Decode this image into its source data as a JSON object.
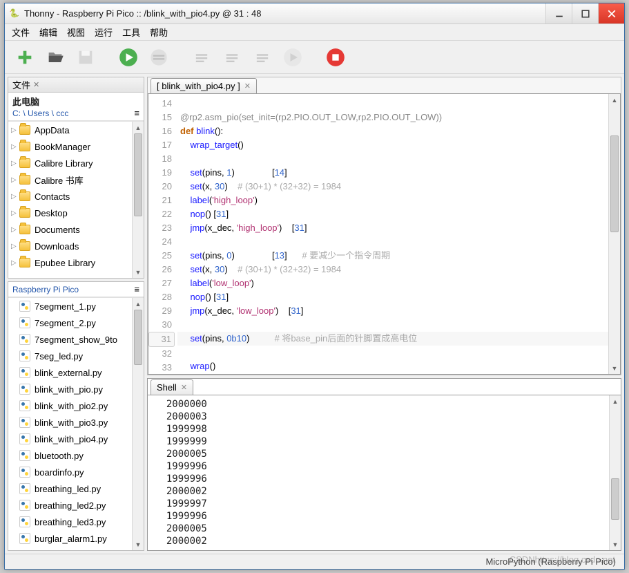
{
  "window": {
    "title": "Thonny  -  Raspberry Pi Pico :: /blink_with_pio4.py  @  31 : 48"
  },
  "menu": [
    "文件",
    "编辑",
    "视图",
    "运行",
    "工具",
    "帮助"
  ],
  "toolbar_icons": [
    "new",
    "open",
    "save",
    "run",
    "debug",
    "step-over",
    "step-into",
    "step-out",
    "resume",
    "stop"
  ],
  "files_panel": {
    "title": "文件",
    "computer_label": "此电脑",
    "path": "C: \\ Users \\ ccc",
    "folders": [
      "AppData",
      "BookManager",
      "Calibre Library",
      "Calibre 书库",
      "Contacts",
      "Desktop",
      "Documents",
      "Downloads",
      "Epubee Library"
    ],
    "device_label": "Raspberry Pi Pico",
    "device_files": [
      "7segment_1.py",
      "7segment_2.py",
      "7segment_show_9to",
      "7seg_led.py",
      "blink_external.py",
      "blink_with_pio.py",
      "blink_with_pio2.py",
      "blink_with_pio3.py",
      "blink_with_pio4.py",
      "bluetooth.py",
      "boardinfo.py",
      "breathing_led.py",
      "breathing_led2.py",
      "breathing_led3.py",
      "burglar_alarm1.py"
    ]
  },
  "editor": {
    "tab_label": "[ blink_with_pio4.py ]",
    "first_line_no": 14,
    "current_line_no": 31,
    "lines": [
      {
        "n": 14,
        "t": ""
      },
      {
        "n": 15,
        "t": "@rp2.asm_pio(set_init=(rp2.PIO.OUT_LOW,rp2.PIO.OUT_LOW))",
        "deco": true
      },
      {
        "n": 16,
        "t": "def blink():",
        "def": true
      },
      {
        "n": 17,
        "t": "    wrap_target()"
      },
      {
        "n": 18,
        "t": ""
      },
      {
        "n": 19,
        "t": "    set(pins, 1)               [14]",
        "nums": [
          [
            "1"
          ],
          [
            "14"
          ]
        ]
      },
      {
        "n": 20,
        "t": "    set(x, 30)    # (30+1) * (32+32) = 1984",
        "num": "30",
        "cmt_from": "#"
      },
      {
        "n": 21,
        "t": "    label('high_loop')",
        "str": "'high_loop'"
      },
      {
        "n": 22,
        "t": "    nop() [31]",
        "nums": [
          [
            "31"
          ]
        ]
      },
      {
        "n": 23,
        "t": "    jmp(x_dec, 'high_loop')    [31]",
        "str": "'high_loop'",
        "nums": [
          [
            "31"
          ]
        ]
      },
      {
        "n": 24,
        "t": ""
      },
      {
        "n": 25,
        "t": "    set(pins, 0)               [13]      # 要减少一个指令周期",
        "nums": [
          [
            "0"
          ],
          [
            "13"
          ]
        ],
        "cmt_from": "#"
      },
      {
        "n": 26,
        "t": "    set(x, 30)    # (30+1) * (32+32) = 1984",
        "num": "30",
        "cmt_from": "#"
      },
      {
        "n": 27,
        "t": "    label('low_loop')",
        "str": "'low_loop'"
      },
      {
        "n": 28,
        "t": "    nop() [31]",
        "nums": [
          [
            "31"
          ]
        ]
      },
      {
        "n": 29,
        "t": "    jmp(x_dec, 'low_loop')    [31]",
        "str": "'low_loop'",
        "nums": [
          [
            "31"
          ]
        ]
      },
      {
        "n": 30,
        "t": ""
      },
      {
        "n": 31,
        "t": "    set(pins, 0b10)          # 将base_pin后面的针脚置成高电位",
        "num": "0b10",
        "cmt_from": "#",
        "cur": true
      },
      {
        "n": 32,
        "t": ""
      },
      {
        "n": 33,
        "t": "    wrap()"
      }
    ]
  },
  "shell": {
    "title": "Shell",
    "lines": [
      "2000000",
      "2000003",
      "1999998",
      "1999999",
      "2000005",
      "1999996",
      "1999996",
      "2000002",
      "1999997",
      "1999996",
      "2000005",
      "2000002"
    ]
  },
  "status": "MicroPython (Raspberry Pi Pico)",
  "watermark": "CSDNhttps://blog.csdn.net"
}
